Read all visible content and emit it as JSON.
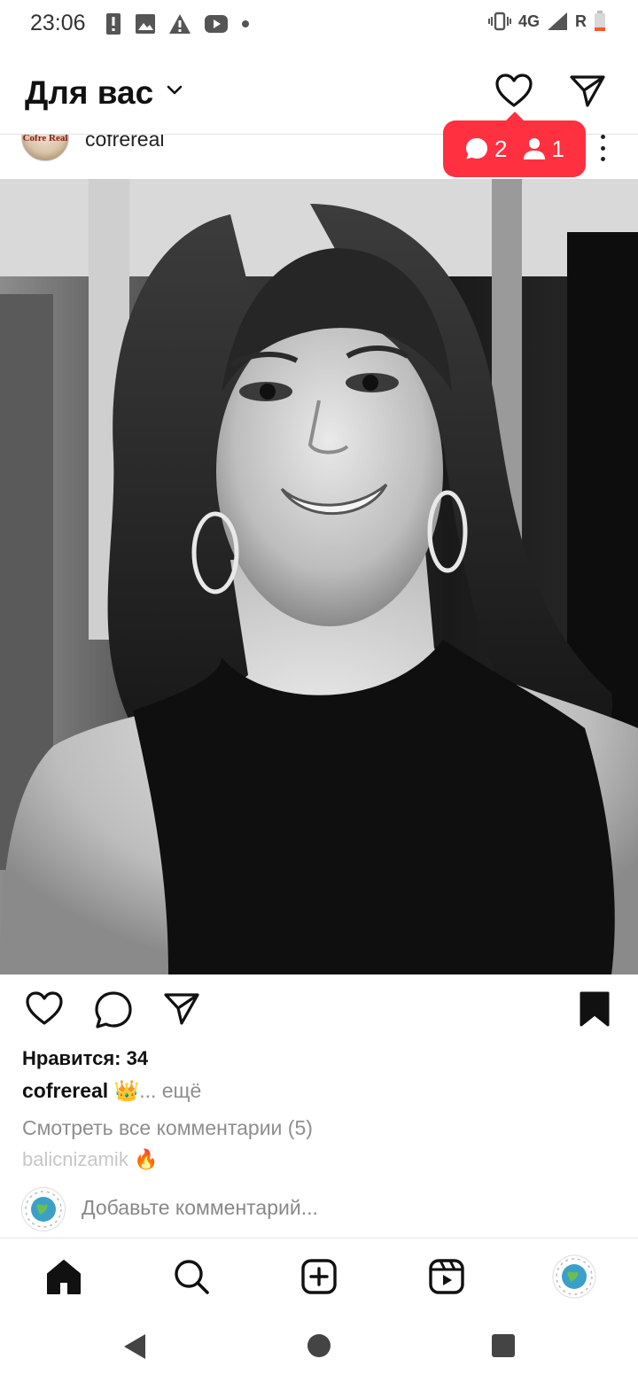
{
  "status_bar": {
    "time": "23:06",
    "left_icons": [
      "alert-icon",
      "image-icon",
      "warning-icon",
      "youtube-icon",
      "dot-icon"
    ],
    "right_icons": [
      "vibrate-icon",
      "signal-icon",
      "battery-low-icon"
    ],
    "network": "4G",
    "roaming": "R"
  },
  "header": {
    "title": "Для вас",
    "icons": [
      "chevron-down-icon",
      "heart-icon",
      "send-icon"
    ]
  },
  "notifications": {
    "comments": "2",
    "followers": "1",
    "color": "#ff3040"
  },
  "post": {
    "username": "cofrereal",
    "avatar_text": "Cofre Real",
    "likes": "Нравится: 34",
    "caption_user": "cofrereal",
    "caption_text": " 👑",
    "caption_more": "... ещё",
    "view_comments": "Смотреть все комментарии (5)",
    "preview_comment_user": "balicnizamik",
    "preview_comment_text": " 🔥"
  },
  "comment_box": {
    "placeholder": "Добавьте комментарий..."
  },
  "bottom_nav": [
    "home-icon",
    "search-icon",
    "create-icon",
    "reels-icon",
    "profile-avatar"
  ],
  "system_nav": [
    "back-icon",
    "home-circle-icon",
    "recents-icon"
  ]
}
